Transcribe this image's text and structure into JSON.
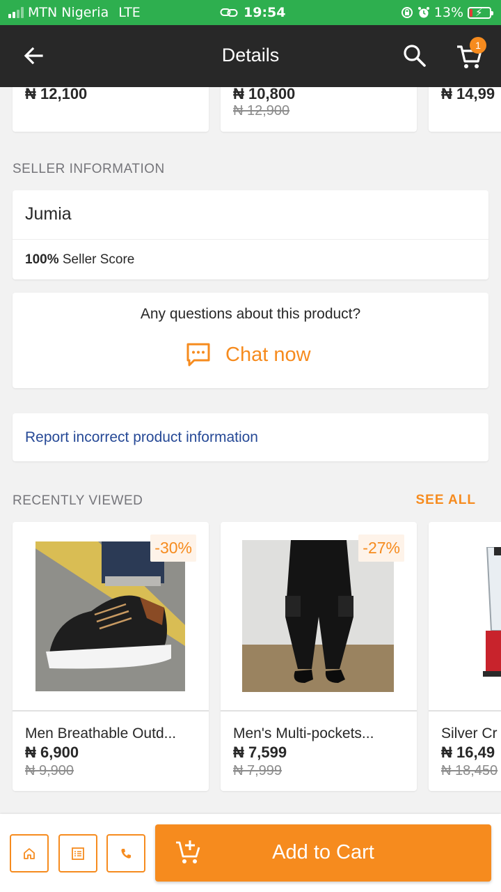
{
  "status_bar": {
    "carrier": "MTN Nigeria",
    "network": "LTE",
    "time": "19:54",
    "battery": "13%",
    "battery_level": 0.13
  },
  "app_bar": {
    "title": "Details",
    "cart_count": "1"
  },
  "top_products": [
    {
      "price": "₦ 12,100",
      "old_price": ""
    },
    {
      "price": "₦ 10,800",
      "old_price": "₦ 12,900"
    },
    {
      "price": "₦ 14,99",
      "old_price": ""
    }
  ],
  "seller": {
    "section_title": "SELLER INFORMATION",
    "name": "Jumia",
    "score_value": "100%",
    "score_label": " Seller Score"
  },
  "questions": {
    "text": "Any questions about this product?",
    "chat_label": "Chat now"
  },
  "report": {
    "text": "Report incorrect product information"
  },
  "recently_viewed": {
    "title": "RECENTLY VIEWED",
    "see_all": "SEE ALL",
    "items": [
      {
        "name": "Men Breathable Outd...",
        "price": "₦ 6,900",
        "old_price": "₦ 9,900",
        "discount": "-30%"
      },
      {
        "name": "Men's Multi-pockets...",
        "price": "₦ 7,599",
        "old_price": "₦ 7,999",
        "discount": "-27%"
      },
      {
        "name": "Silver Cr",
        "price": "₦ 16,49",
        "old_price": "₦ 18,450",
        "discount": ""
      }
    ]
  },
  "bottom_bar": {
    "add_to_cart": "Add to Cart"
  },
  "colors": {
    "accent": "#f68b1e",
    "app_bar": "#282828",
    "status_bar": "#2eaf4f",
    "link": "#264996"
  }
}
